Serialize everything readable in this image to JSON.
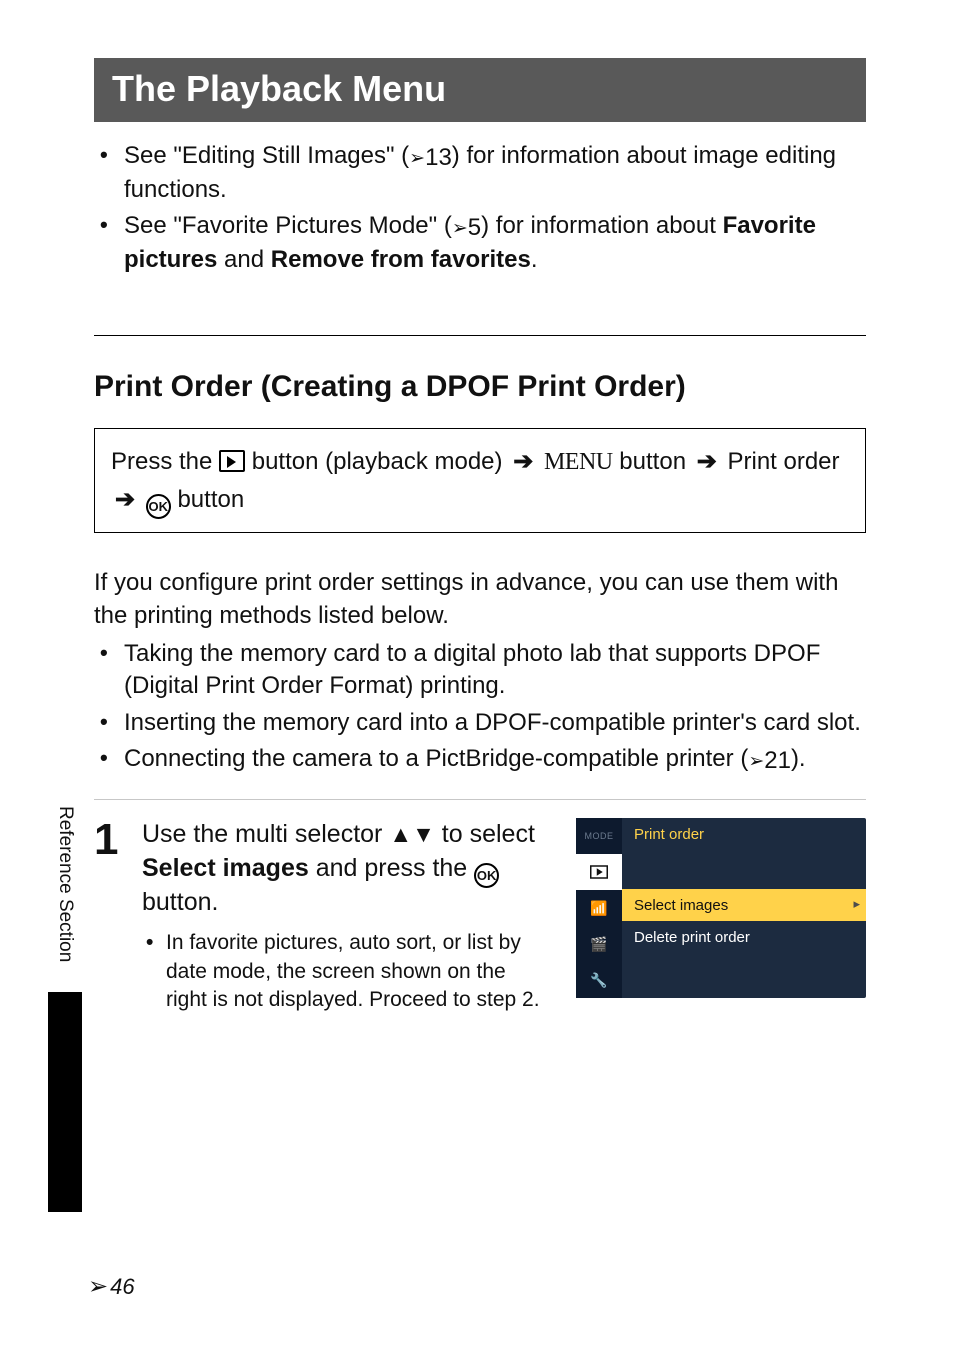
{
  "title": "The Playback Menu",
  "intro_bullets": [
    {
      "pre": "See \"Editing Still Images\" (",
      "ref": "13",
      "post": ") for information about image editing functions."
    },
    {
      "pre": "See \"Favorite Pictures Mode\" (",
      "ref": "5",
      "post": ") for information about ",
      "bold1": "Favorite pictures",
      "mid": " and ",
      "bold2": "Remove from favorites",
      "tail": "."
    }
  ],
  "section_heading": "Print Order (Creating a DPOF Print Order)",
  "press_box": {
    "lead": "Press the ",
    "seg1": " button (playback mode) ",
    "menu": "MENU",
    "seg2": " button ",
    "item": " Print order ",
    "tail": "button"
  },
  "paragraph": "If you configure print order settings in advance, you can use them with the printing methods listed below.",
  "method_bullets": [
    "Taking the memory card to a digital photo lab that supports DPOF (Digital Print Order Format) printing.",
    "Inserting the memory card into a DPOF-compatible printer's card slot."
  ],
  "method_bullet3": {
    "pre": "Connecting the camera to a PictBridge-compatible printer (",
    "ref": "21",
    "post": ")."
  },
  "step": {
    "num": "1",
    "line1a": "Use the multi selector ",
    "line1b": " to select ",
    "bold": "Select images",
    "line1c": " and press the ",
    "line1d": " button.",
    "sub": "In favorite pictures, auto sort, or list by date mode, the screen shown on the right is not displayed. Proceed to step 2."
  },
  "screen": {
    "title": "Print order",
    "items": [
      {
        "label": "Select images",
        "selected": true
      },
      {
        "label": "Delete print order",
        "selected": false
      }
    ]
  },
  "side_label": "Reference Section",
  "page_number": "46"
}
